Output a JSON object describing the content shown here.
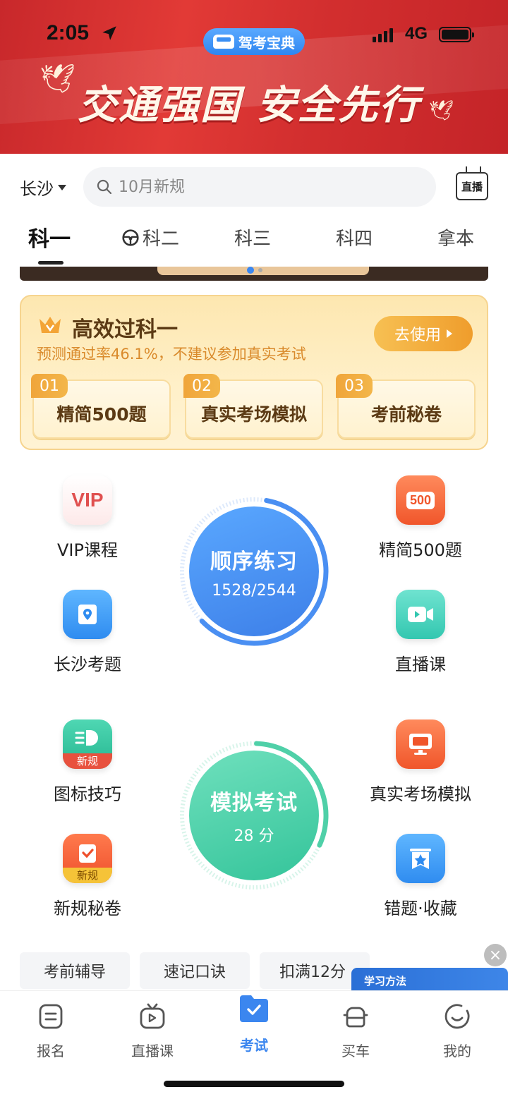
{
  "status_bar": {
    "time": "2:05",
    "network": "4G",
    "app_name": "驾考宝典"
  },
  "banner": {
    "slogan": "交通强国 安全先行"
  },
  "search_row": {
    "city": "长沙",
    "search_placeholder": "10月新规",
    "live_label": "直播"
  },
  "subject_tabs": [
    {
      "label": "科一",
      "active": true
    },
    {
      "label": "科二",
      "active": false,
      "icon": "steering-wheel-icon"
    },
    {
      "label": "科三",
      "active": false
    },
    {
      "label": "科四",
      "active": false
    },
    {
      "label": "拿本",
      "active": false
    }
  ],
  "promo": {
    "title": "高效过科一",
    "subtitle": "预测通过率46.1%，不建议参加真实考试",
    "button": "去使用",
    "items": [
      {
        "num": "01",
        "label": "精简500题"
      },
      {
        "num": "02",
        "label": "真实考场模拟"
      },
      {
        "num": "03",
        "label": "考前秘卷"
      }
    ]
  },
  "grid": {
    "left_top": [
      {
        "label": "VIP课程",
        "icon": "vip-icon"
      },
      {
        "label": "长沙考题",
        "icon": "location-book-icon"
      }
    ],
    "right_top": [
      {
        "label": "精简500题",
        "icon": "500-icon"
      },
      {
        "label": "直播课",
        "icon": "video-camera-icon"
      }
    ],
    "left_bottom": [
      {
        "label": "图标技巧",
        "icon": "headlight-icon",
        "badge": "新规"
      },
      {
        "label": "新规秘卷",
        "icon": "clipboard-check-icon",
        "badge": "新规"
      }
    ],
    "right_bottom": [
      {
        "label": "真实考场模拟",
        "icon": "monitor-icon"
      },
      {
        "label": "错题·收藏",
        "icon": "star-bookmark-icon"
      }
    ]
  },
  "practice_ring": {
    "title": "顺序练习",
    "progress_text": "1528/2544",
    "progress": 0.6006
  },
  "exam_ring": {
    "title": "模拟考试",
    "score_text": "28 分"
  },
  "quick_links": [
    "考前辅导",
    "速记口诀",
    "扣满12分"
  ],
  "floating_card": {
    "title": "学习方法"
  },
  "tabbar": [
    {
      "label": "报名",
      "icon": "form-icon",
      "active": false
    },
    {
      "label": "直播课",
      "icon": "tv-icon",
      "active": false
    },
    {
      "label": "考试",
      "icon": "folder-check-icon",
      "active": true
    },
    {
      "label": "买车",
      "icon": "car-icon",
      "active": false
    },
    {
      "label": "我的",
      "icon": "smile-icon",
      "active": false
    }
  ],
  "colors": {
    "brand_blue": "#3b86ef",
    "banner_red": "#d32f2f",
    "practice_blue": "#4a8ff2",
    "exam_green": "#4fd0a8",
    "promo_gold": "#f0a53a"
  }
}
